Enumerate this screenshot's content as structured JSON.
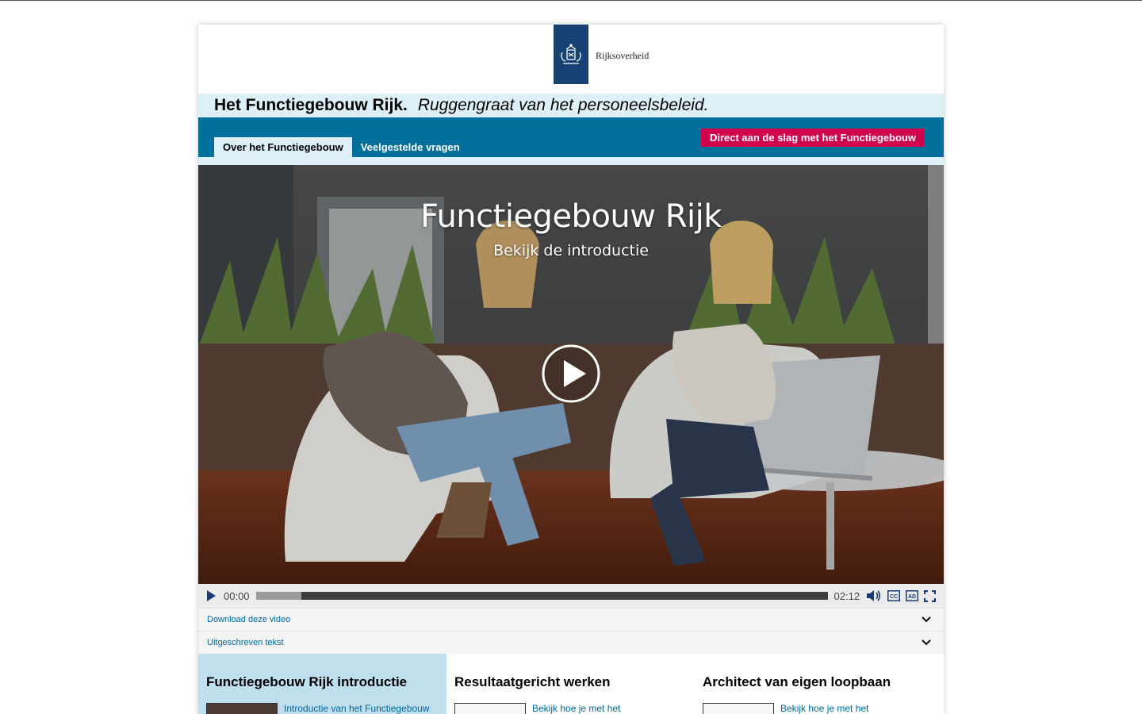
{
  "brand": {
    "org_name": "Rijksoverheid"
  },
  "header": {
    "title": "Het Functiegebouw Rijk.",
    "tagline": "Ruggengraat van het personeelsbeleid."
  },
  "nav": {
    "tabs": [
      {
        "label": "Over het Functiegebouw",
        "active": true
      },
      {
        "label": "Veelgestelde vragen",
        "active": false
      }
    ],
    "cta_label": "Direct aan de slag met het Functiegebouw"
  },
  "video": {
    "overlay_title": "Functiegebouw Rijk",
    "overlay_subtitle": "Bekijk de introductie",
    "current_time": "00:00",
    "duration": "02:12",
    "buffered_fraction": 0.08,
    "control_icons": [
      "play-icon",
      "volume-icon",
      "captions-icon",
      "audio-description-icon",
      "fullscreen-icon"
    ]
  },
  "accordions": [
    {
      "label": "Download deze video"
    },
    {
      "label": "Uitgeschreven tekst"
    }
  ],
  "sections": [
    {
      "heading": "Functiegebouw Rijk introductie",
      "link": "Introductie van het Functiegebouw"
    },
    {
      "heading": "Resultaatgericht werken",
      "link": "Bekijk hoe je met het"
    },
    {
      "heading": "Architect van eigen loopbaan",
      "link": "Bekijk hoe je met het"
    }
  ],
  "colors": {
    "navy": "#154273",
    "nav_blue": "#006f9c",
    "light_blue": "#ddeff7",
    "cta_red": "#d1004e",
    "link": "#00689b"
  }
}
